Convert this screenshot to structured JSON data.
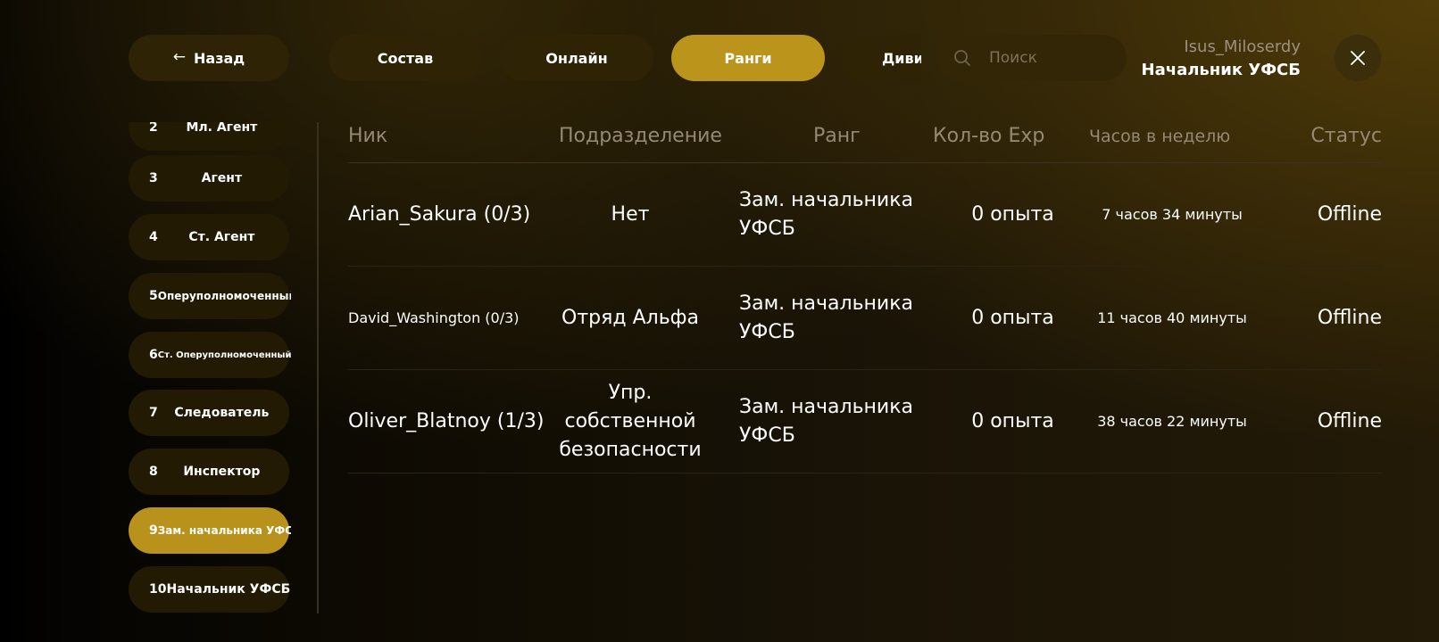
{
  "header": {
    "back_label": "Назад",
    "tabs": [
      {
        "label": "Состав"
      },
      {
        "label": "Онлайн"
      },
      {
        "label": "Ранги"
      },
      {
        "label": "Дивизионы"
      }
    ],
    "active_tab": 2,
    "search": {
      "value": "",
      "placeholder": "Поиск"
    },
    "user": {
      "name": "Isus_Miloserdy",
      "rank": "Начальник УФСБ"
    },
    "icons": {
      "back": "arrow-left-icon",
      "search": "search-icon",
      "close": "close-icon"
    }
  },
  "sidebar": {
    "items": [
      {
        "num": "2",
        "label": "Мл. Агент"
      },
      {
        "num": "3",
        "label": "Агент"
      },
      {
        "num": "4",
        "label": "Ст. Агент"
      },
      {
        "num": "5",
        "label": "Оперуполномоченный"
      },
      {
        "num": "6",
        "label": "Ст. Оперуполномоченный"
      },
      {
        "num": "7",
        "label": "Следователь"
      },
      {
        "num": "8",
        "label": "Инспектор"
      },
      {
        "num": "9",
        "label": "Зам. начальника УФСБ"
      },
      {
        "num": "10",
        "label": "Начальник УФСБ"
      }
    ],
    "active_index": 7
  },
  "table": {
    "columns": [
      "Ник",
      "Подразделение",
      "Ранг",
      "Кол-во Exp",
      "Часов в неделю",
      "Статус"
    ],
    "rows": [
      {
        "nick": "Arian_Sakura (0/3)",
        "division": "Нет",
        "rank": "Зам. начальника УФСБ",
        "exp": "0 опыта",
        "hours": "7 часов 34 минуты",
        "status": "Offline"
      },
      {
        "nick": "David_Washington (0/3)",
        "division": "Отряд Альфа",
        "rank": "Зам. начальника УФСБ",
        "exp": "0 опыта",
        "hours": "11 часов 40 минуты",
        "status": "Offline"
      },
      {
        "nick": "Oliver_Blatnoy (1/3)",
        "division": "Упр. собственной безопасности",
        "rank": "Зам. начальника УФСБ",
        "exp": "0 опыта",
        "hours": "38 часов 22 минуты",
        "status": "Offline"
      }
    ]
  },
  "colors": {
    "accent": "#bb951b",
    "pill": "#2e2305",
    "text_muted": "#948a74"
  }
}
